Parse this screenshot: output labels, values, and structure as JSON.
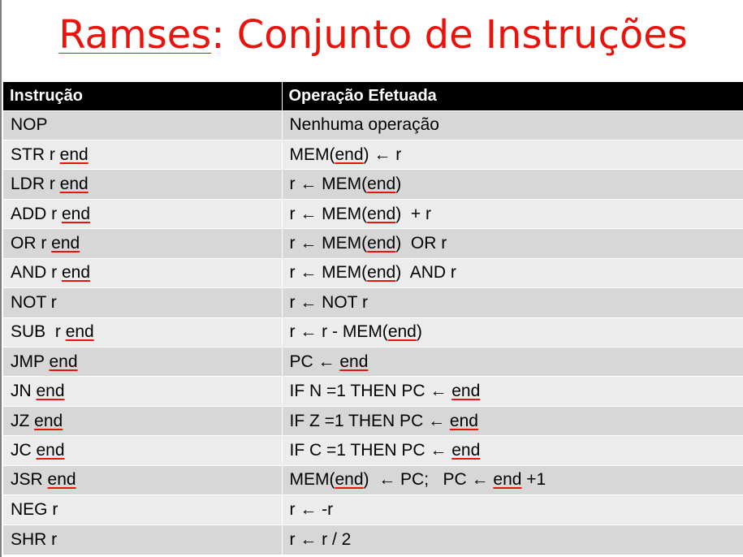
{
  "title": {
    "word1": "Ramses",
    "rest": ": Conjunto de Instruções"
  },
  "table": {
    "headers": [
      "Instrução",
      "Operação Efetuada"
    ],
    "rows": [
      {
        "instr": [
          {
            "t": "NOP"
          }
        ],
        "op": [
          {
            "t": "Nenhuma operação"
          }
        ]
      },
      {
        "instr": [
          {
            "t": "STR r "
          },
          {
            "t": "end",
            "u": true
          }
        ],
        "op": [
          {
            "t": "MEM("
          },
          {
            "t": "end",
            "u": true
          },
          {
            "t": ") ← r"
          }
        ]
      },
      {
        "instr": [
          {
            "t": "LDR r "
          },
          {
            "t": "end",
            "u": true
          }
        ],
        "op": [
          {
            "t": "r ← MEM("
          },
          {
            "t": "end",
            "u": true
          },
          {
            "t": ")"
          }
        ]
      },
      {
        "instr": [
          {
            "t": "ADD r "
          },
          {
            "t": "end",
            "u": true
          }
        ],
        "op": [
          {
            "t": "r ← MEM("
          },
          {
            "t": "end",
            "u": true
          },
          {
            "t": ")  + r"
          }
        ]
      },
      {
        "instr": [
          {
            "t": "OR r "
          },
          {
            "t": "end",
            "u": true
          }
        ],
        "op": [
          {
            "t": "r ← MEM("
          },
          {
            "t": "end",
            "u": true
          },
          {
            "t": ")  OR r"
          }
        ]
      },
      {
        "instr": [
          {
            "t": "AND r "
          },
          {
            "t": "end",
            "u": true
          }
        ],
        "op": [
          {
            "t": "r ← MEM("
          },
          {
            "t": "end",
            "u": true
          },
          {
            "t": ")  AND r"
          }
        ]
      },
      {
        "instr": [
          {
            "t": "NOT r"
          }
        ],
        "op": [
          {
            "t": "r ← NOT r"
          }
        ]
      },
      {
        "instr": [
          {
            "t": "SUB  r "
          },
          {
            "t": "end",
            "u": true
          }
        ],
        "op": [
          {
            "t": "r ← r - MEM("
          },
          {
            "t": "end",
            "u": true
          },
          {
            "t": ")"
          }
        ]
      },
      {
        "instr": [
          {
            "t": "JMP "
          },
          {
            "t": "end",
            "u": true
          }
        ],
        "op": [
          {
            "t": "PC ← "
          },
          {
            "t": "end",
            "u": true
          }
        ]
      },
      {
        "instr": [
          {
            "t": "JN "
          },
          {
            "t": "end",
            "u": true
          }
        ],
        "op": [
          {
            "t": "IF N =1 THEN PC ← "
          },
          {
            "t": "end",
            "u": true
          }
        ]
      },
      {
        "instr": [
          {
            "t": "JZ "
          },
          {
            "t": "end",
            "u": true
          }
        ],
        "op": [
          {
            "t": "IF Z =1 THEN PC ← "
          },
          {
            "t": "end",
            "u": true
          }
        ]
      },
      {
        "instr": [
          {
            "t": "JC "
          },
          {
            "t": "end",
            "u": true
          }
        ],
        "op": [
          {
            "t": "IF C =1 THEN PC ← "
          },
          {
            "t": "end",
            "u": true
          }
        ]
      },
      {
        "instr": [
          {
            "t": "JSR "
          },
          {
            "t": "end",
            "u": true
          }
        ],
        "op": [
          {
            "t": "MEM("
          },
          {
            "t": "end",
            "u": true
          },
          {
            "t": ")  ← PC;   PC ← "
          },
          {
            "t": "end",
            "u": true
          },
          {
            "t": " +1"
          }
        ]
      },
      {
        "instr": [
          {
            "t": "NEG r"
          }
        ],
        "op": [
          {
            "t": "r ← -r"
          }
        ]
      },
      {
        "instr": [
          {
            "t": "SHR r"
          }
        ],
        "op": [
          {
            "t": "r ← r / 2"
          }
        ]
      }
    ]
  },
  "colors": {
    "title": "#e8130c",
    "header_bg": "#000000",
    "row_odd": "#d7d7d7",
    "row_even": "#ececec",
    "spellcheck_underline": "#e8130c"
  }
}
